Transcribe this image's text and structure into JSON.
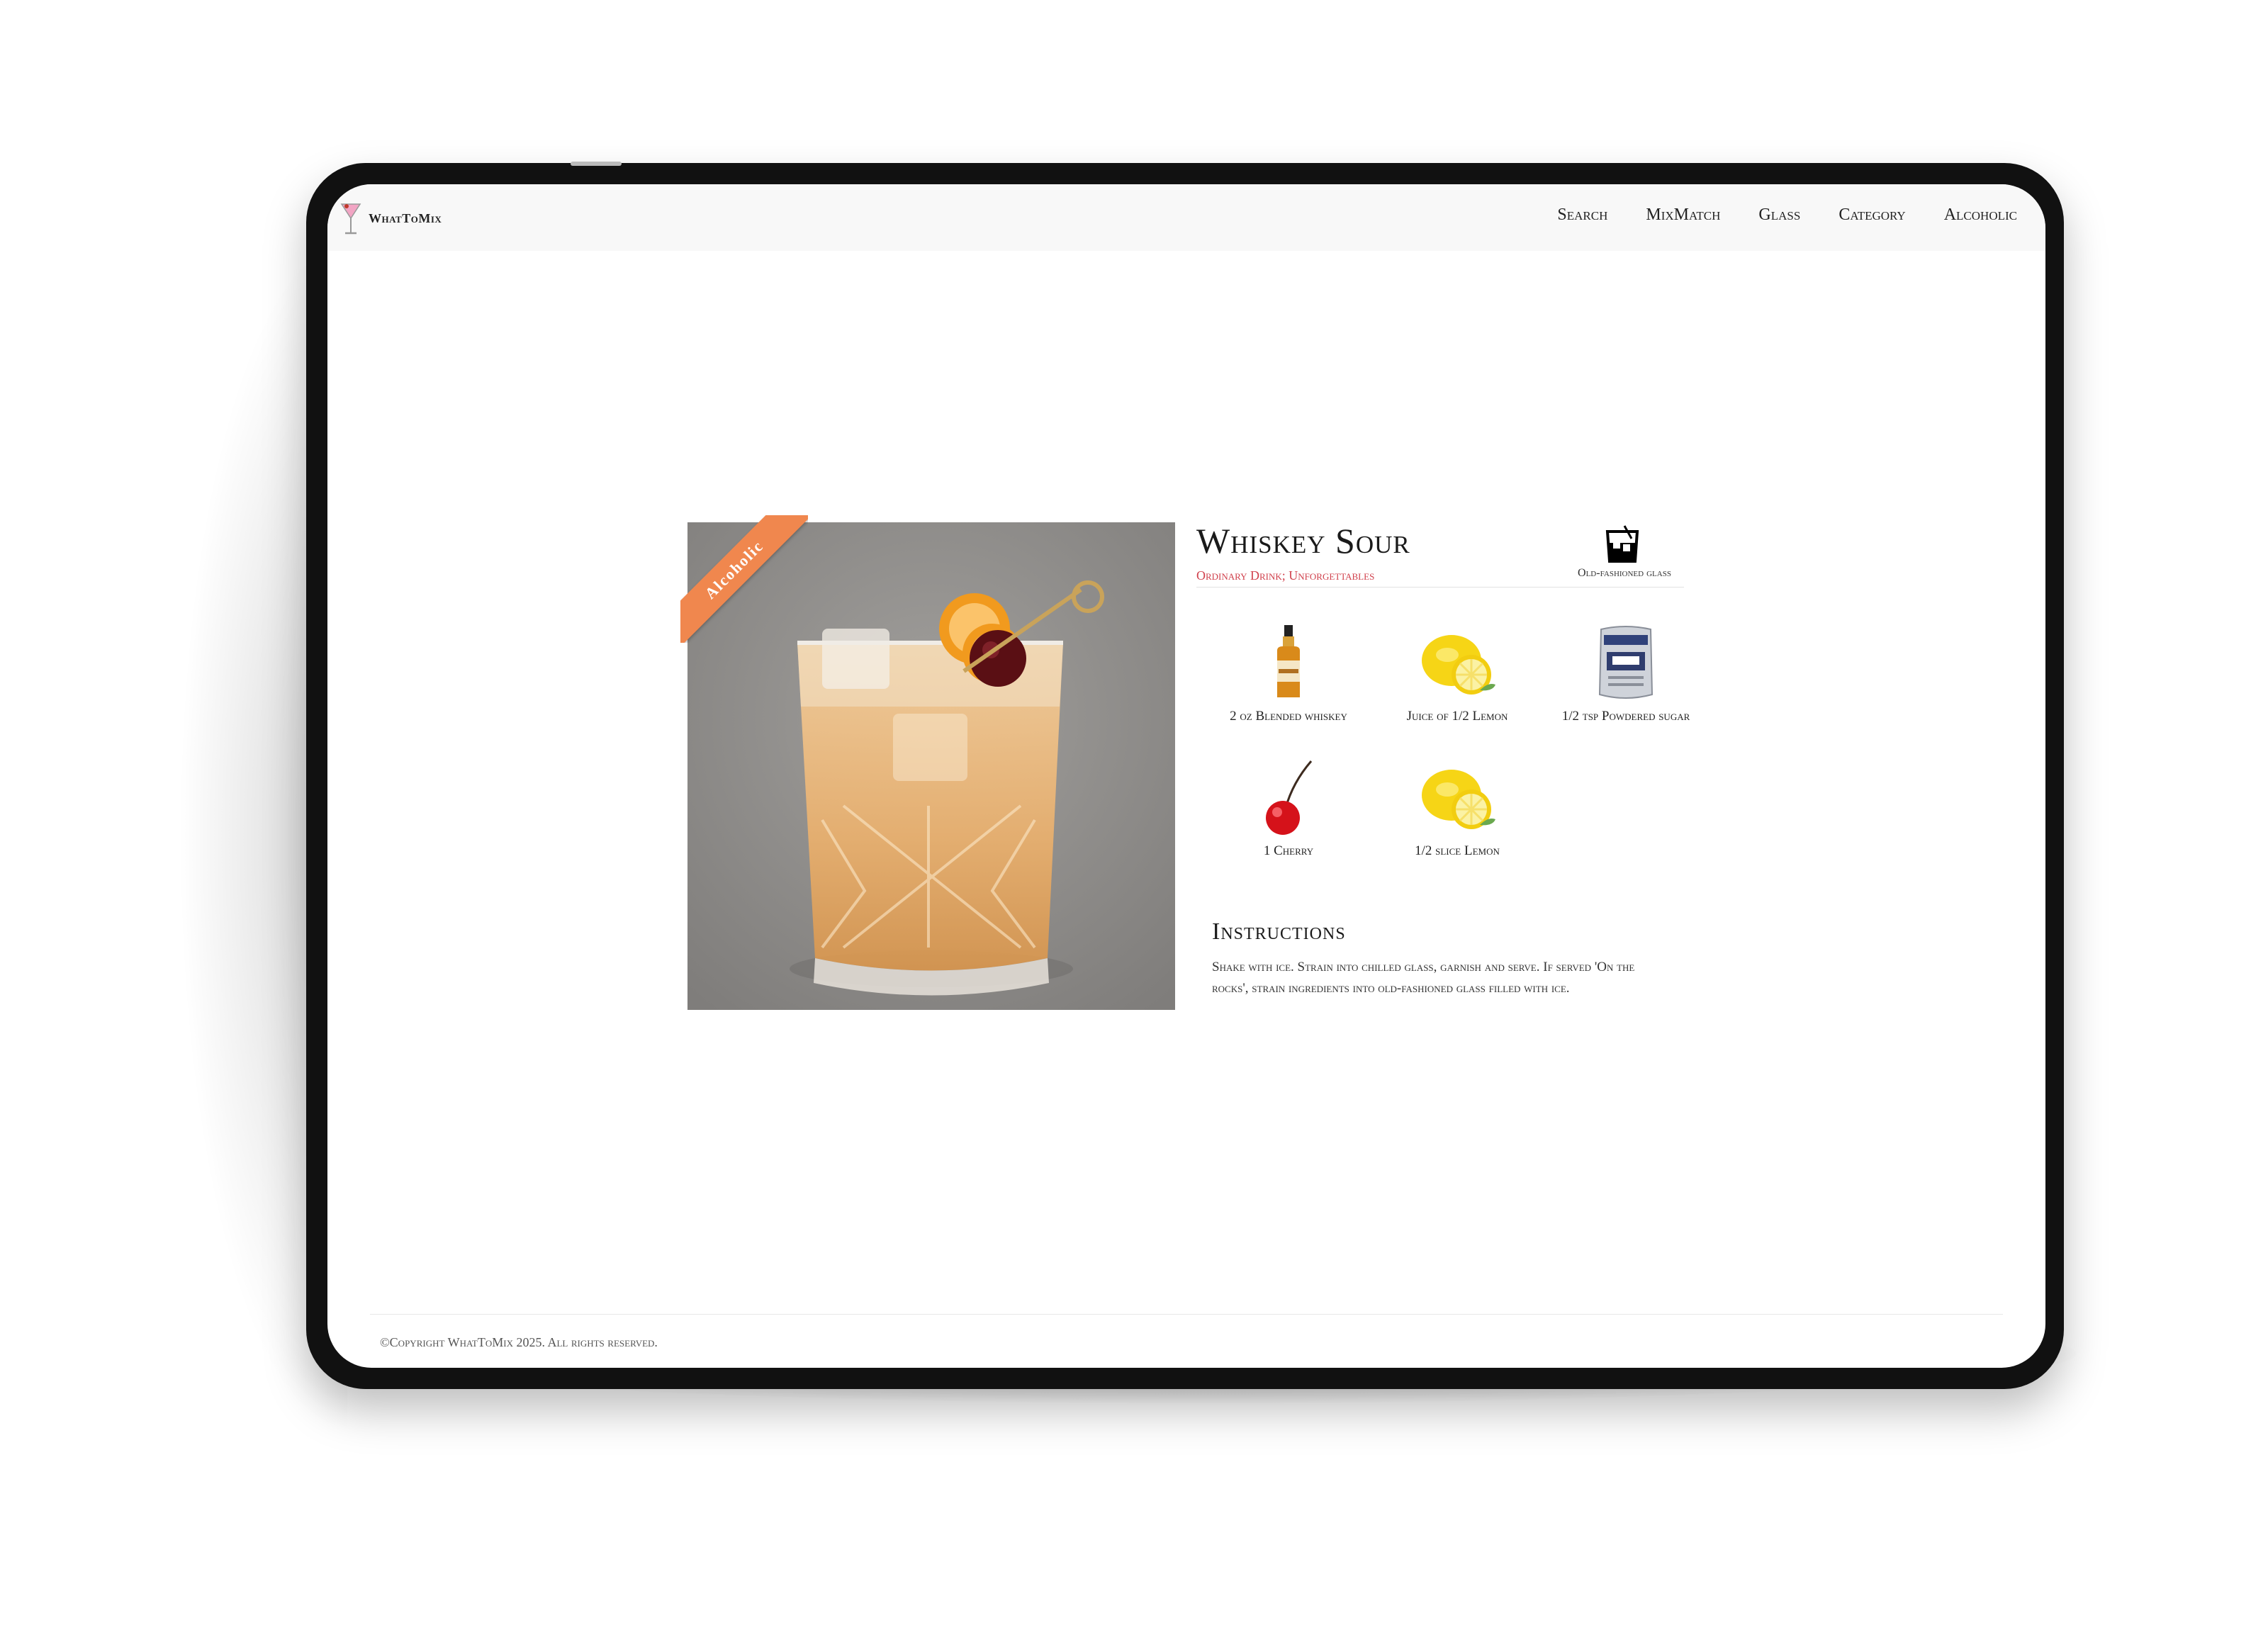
{
  "brand": {
    "name": "WhatToMix",
    "logo_icon": "cocktail-glass-icon"
  },
  "nav": [
    {
      "label": "Search"
    },
    {
      "label": "MixMatch"
    },
    {
      "label": "Glass"
    },
    {
      "label": "Category"
    },
    {
      "label": "Alcoholic"
    }
  ],
  "drink": {
    "badge": "Alcoholic",
    "name": "Whiskey Sour",
    "tags": "Ordinary Drink; Unforgettables",
    "glass": {
      "label": "Old-fashioned glass",
      "icon": "old-fashioned-glass-icon"
    },
    "image_icon": "whiskey-sour-photo"
  },
  "ingredients": [
    {
      "label": "2 oz Blended whiskey",
      "icon": "whiskey-bottle-icon"
    },
    {
      "label": "Juice of 1/2 Lemon",
      "icon": "lemon-icon"
    },
    {
      "label": "1/2 tsp Powdered sugar",
      "icon": "sugar-bag-icon"
    },
    {
      "label": "1 Cherry",
      "icon": "cherry-icon"
    },
    {
      "label": "1/2 slice Lemon",
      "icon": "lemon-icon"
    }
  ],
  "instructions": {
    "title": "Instructions",
    "text": "Shake with ice. Strain into chilled glass, garnish and serve. If served 'On the rocks', strain ingredients into old-fashioned glass filled with ice."
  },
  "footer": {
    "copyright": "©Copyright WhatToMix 2025. All rights reserved."
  },
  "colors": {
    "accent": "#d0404c",
    "badge": "#f0874e",
    "navbar_bg": "#f8f8f8",
    "device_frame": "#111111"
  }
}
